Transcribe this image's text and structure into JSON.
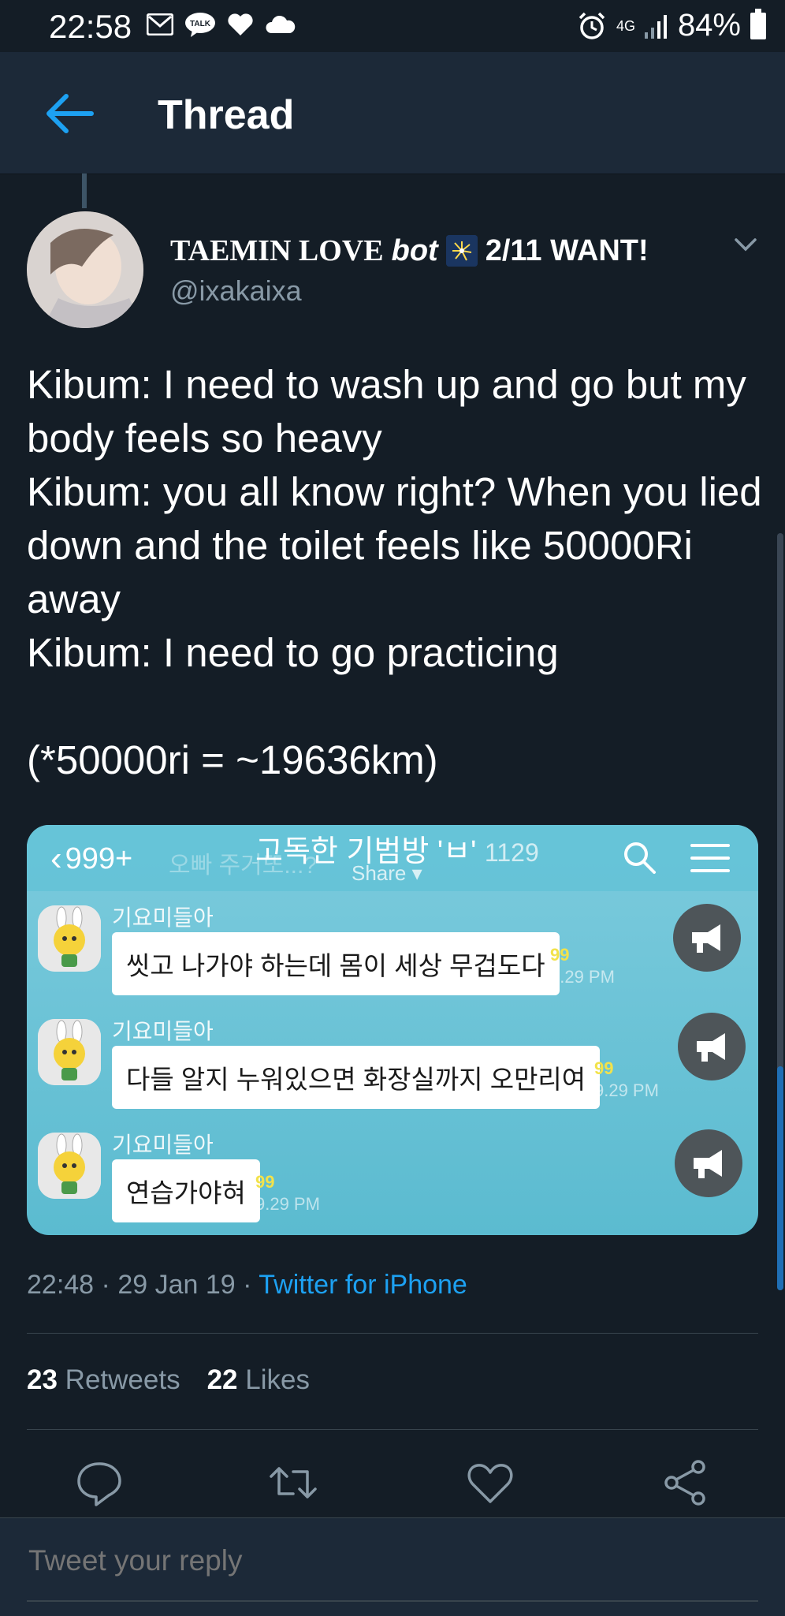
{
  "status_bar": {
    "time": "22:58",
    "network": "4G",
    "battery": "84%"
  },
  "header": {
    "title": "Thread"
  },
  "tweet": {
    "author_name_prefix": "TAEMIN LOVE",
    "author_name_bot": "bot",
    "author_name_suffix": "2/11 WANT!",
    "handle": "@ixakaixa",
    "text": "Kibum: I need to wash up and go but my body feels so heavy\nKibum: you all know right? When you lied down and the toilet feels like 50000Ri away\nKibum: I need to go practicing\n\n(*50000ri = ~19636km)",
    "time": "22:48",
    "date": "29 Jan 19",
    "source": "Twitter for iPhone",
    "retweets_count": "23",
    "retweets_label": "Retweets",
    "likes_count": "22",
    "likes_label": "Likes"
  },
  "embedded_image": {
    "back_count": "999+",
    "ghost_text": "오빠 주거또...?",
    "room_title": "고독한 기범방 'ㅂ'",
    "member_count": "1129",
    "share_label": "Share",
    "messages": [
      {
        "sender": "기요미들아",
        "text": "씻고 나가야 하는데 몸이 세상 무겁도다",
        "unread": "99",
        "time": "9.29 PM"
      },
      {
        "sender": "기요미들아",
        "text": "다들 알지 누워있으면 화장실까지 오만리여",
        "unread": "99",
        "time": "9.29 PM"
      },
      {
        "sender": "기요미들아",
        "text": "연습가야혀",
        "unread": "99",
        "time": "9.29 PM"
      }
    ]
  },
  "reply": {
    "placeholder": "Tweet your reply"
  },
  "colors": {
    "background": "#141d26",
    "header": "#1c2938",
    "accent": "#1da1f2",
    "secondary_text": "#8899a6",
    "kakao_bg": "#6cc4d8"
  },
  "icons": [
    "mail-icon",
    "talk-icon",
    "heart-icon",
    "cloud-icon",
    "alarm-icon",
    "signal-icon",
    "battery-icon",
    "back-arrow-icon",
    "chevron-down-icon",
    "search-icon",
    "menu-icon",
    "megaphone-icon",
    "reply-icon",
    "retweet-icon",
    "like-icon",
    "share-icon"
  ]
}
